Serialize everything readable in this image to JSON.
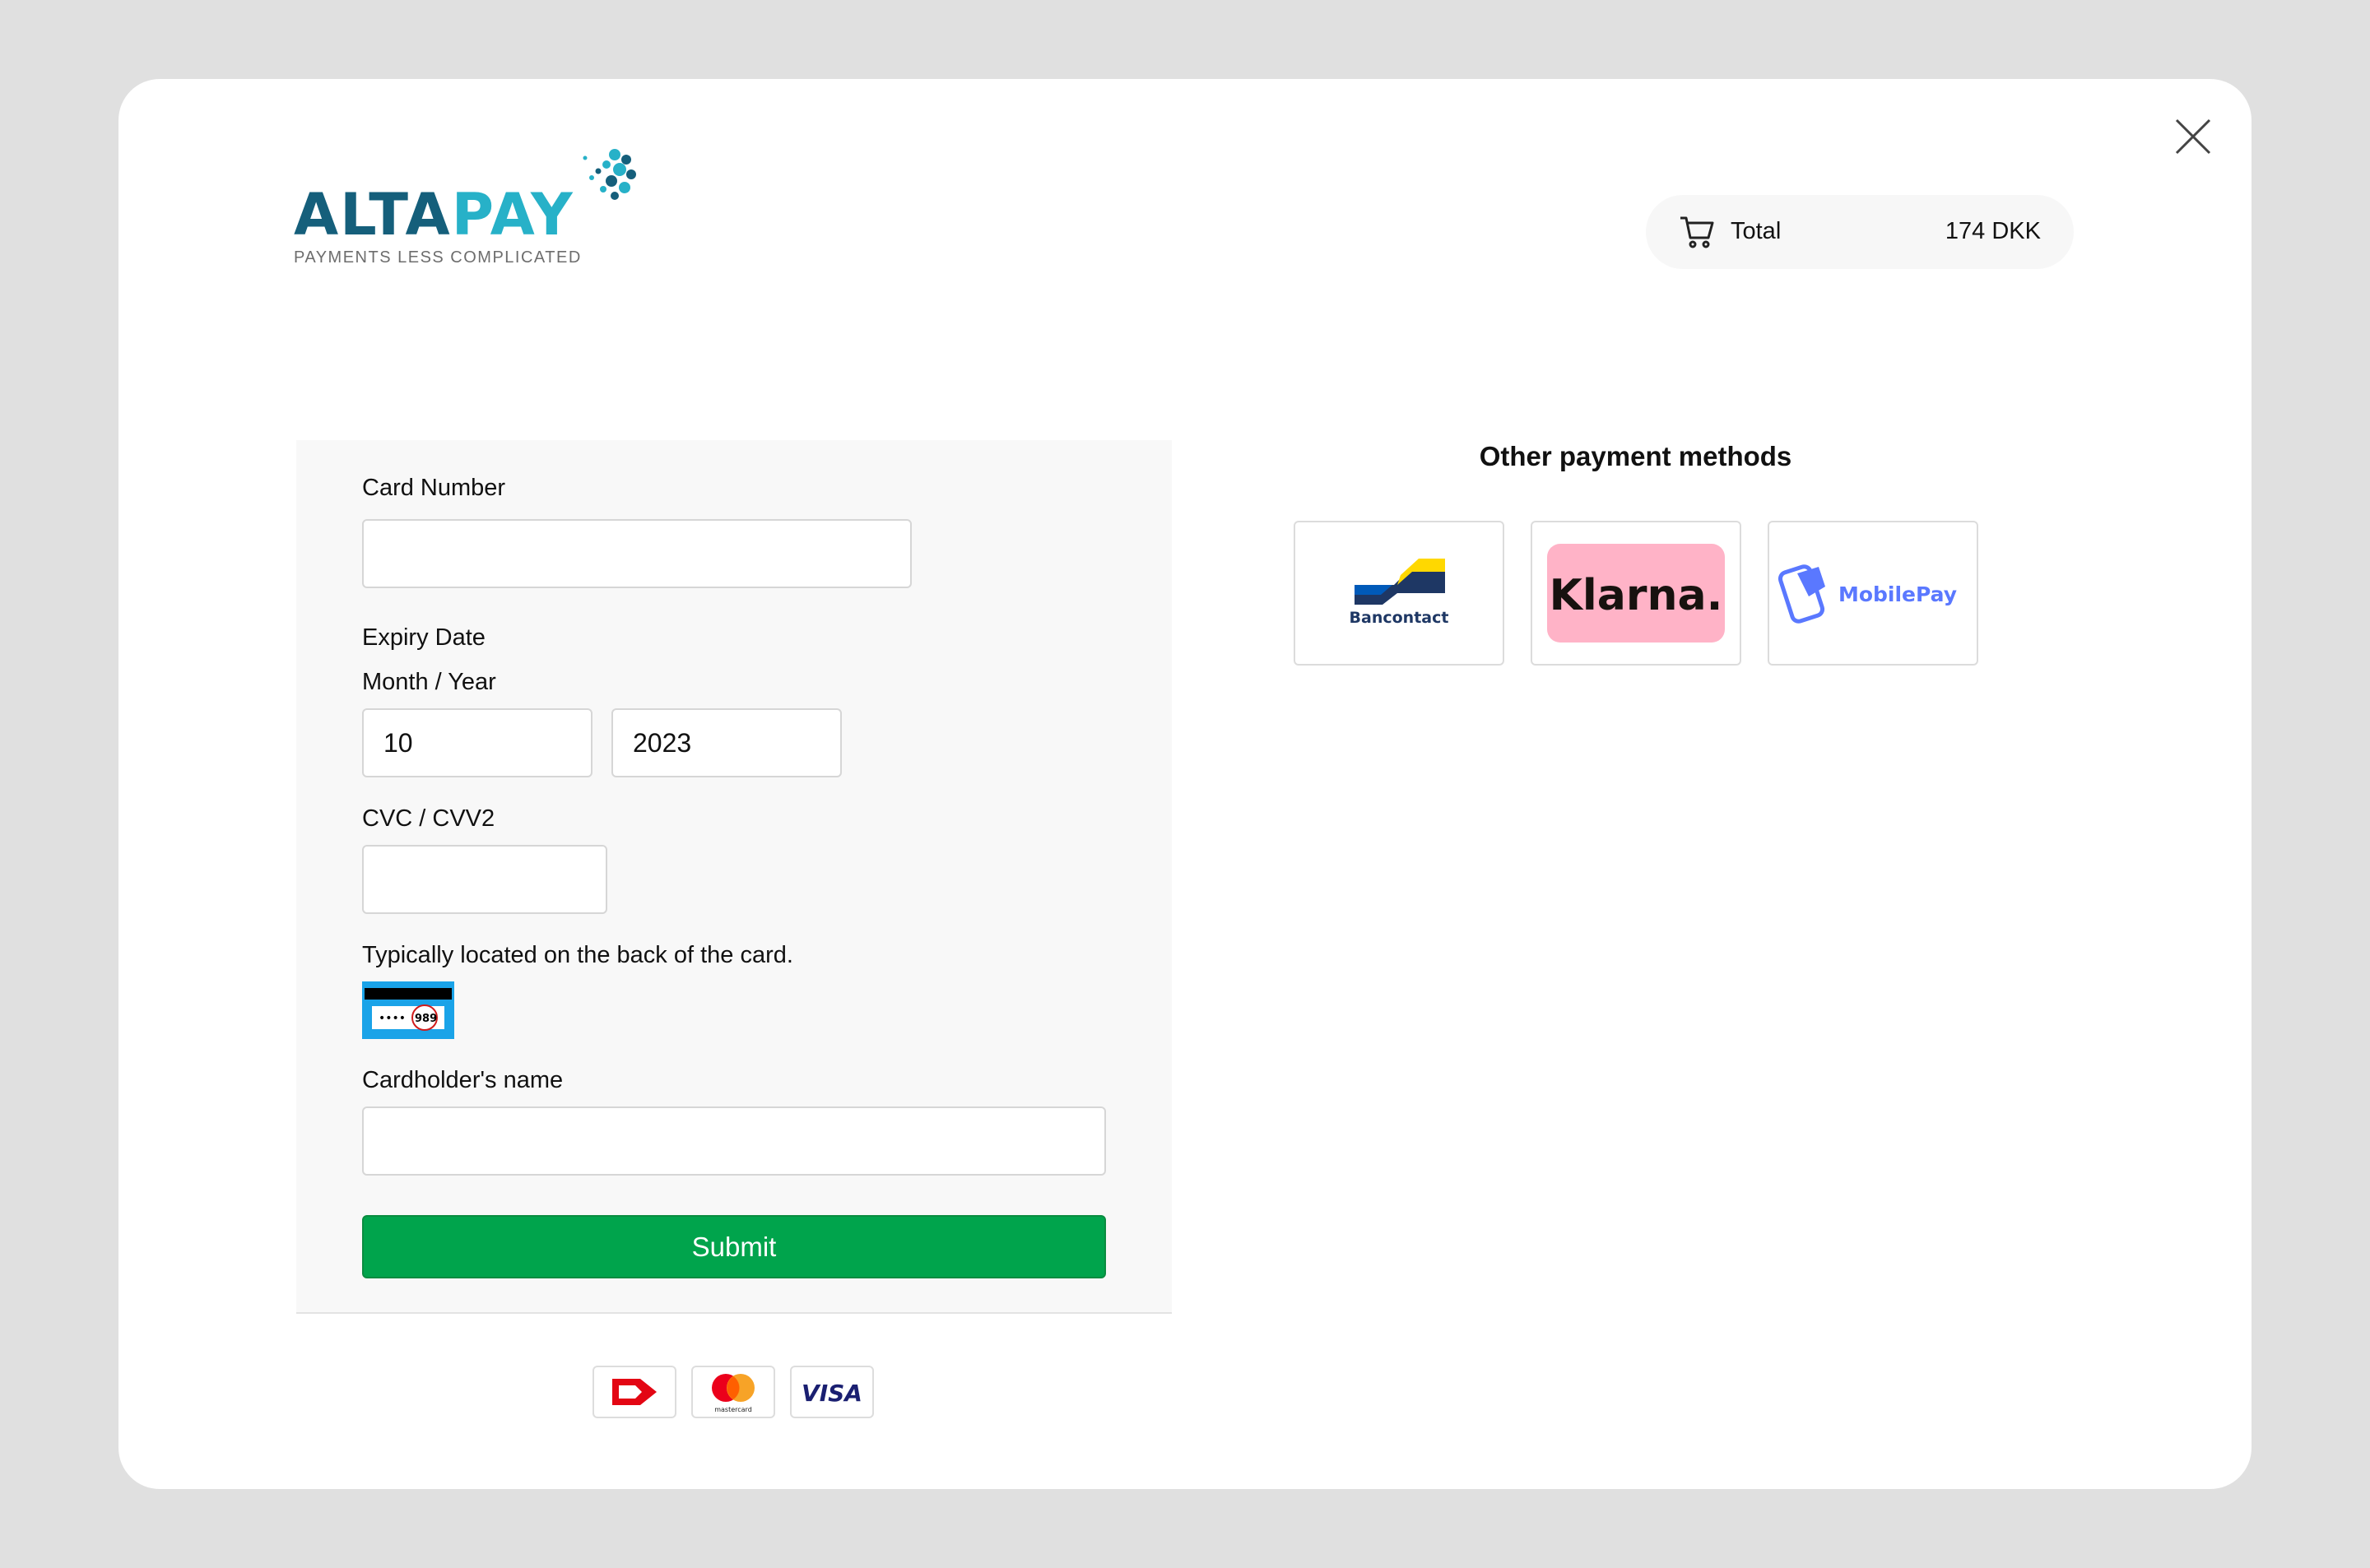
{
  "logo": {
    "word_part1": "ALTA",
    "word_part2": "PAY",
    "tagline": "PAYMENTS LESS COMPLICATED"
  },
  "summary": {
    "total_label": "Total",
    "total_amount": "174 DKK"
  },
  "form": {
    "card_number_label": "Card Number",
    "card_number_value": "",
    "expiry_label": "Expiry Date",
    "month_year_label": "Month / Year",
    "month_value": "10",
    "year_value": "2023",
    "cvc_label": "CVC / CVV2",
    "cvc_value": "",
    "cvc_hint": "Typically located on the back of the card.",
    "cvc_card_digits": "989",
    "cardholder_label": "Cardholder's name",
    "cardholder_value": "",
    "submit_label": "Submit"
  },
  "card_brands": [
    {
      "name": "dankort-icon"
    },
    {
      "name": "mastercard-icon",
      "text": "mastercard"
    },
    {
      "name": "visa-icon",
      "text": "VISA"
    }
  ],
  "other_methods": {
    "title": "Other payment methods",
    "items": [
      {
        "id": "bancontact",
        "label": "Bancontact"
      },
      {
        "id": "klarna",
        "label": "Klarna."
      },
      {
        "id": "mobilepay",
        "label": "MobilePay"
      }
    ]
  },
  "colors": {
    "submit_green": "#00a44c",
    "logo_dark": "#155f7b",
    "logo_light": "#27b1c8",
    "klarna_pink": "#ffb3c7",
    "mobilepay_blue": "#5a78ff"
  }
}
